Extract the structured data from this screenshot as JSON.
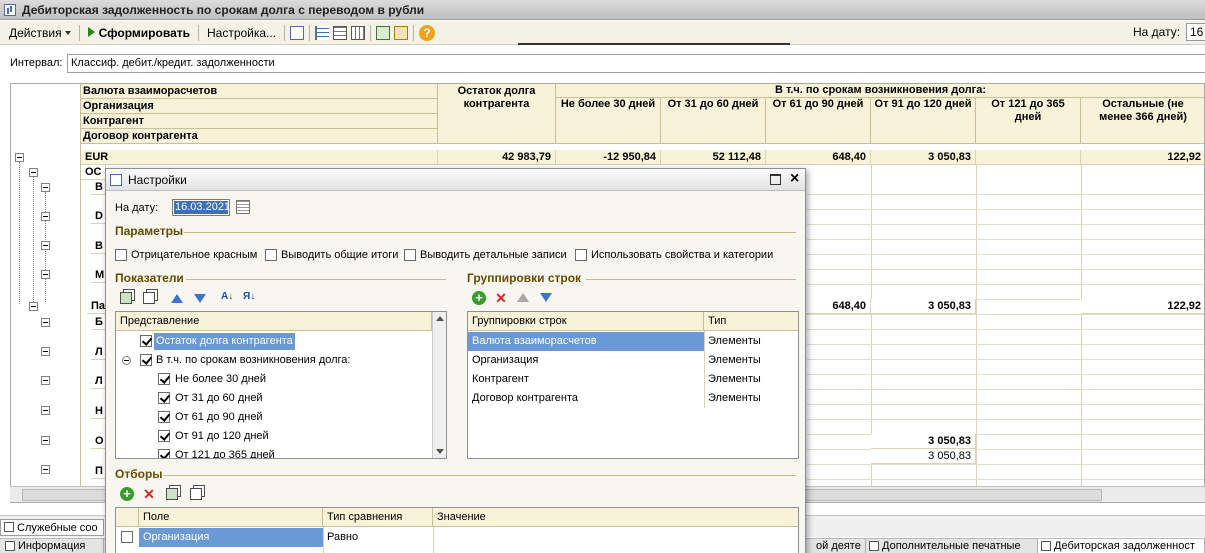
{
  "window": {
    "title": "Дебиторская задолженность по срокам долга с переводом в рубли"
  },
  "toolbar": {
    "actions_label": "Действия",
    "generate_label": "Сформировать",
    "settings_label": "Настройка...",
    "date_label": "На дату:",
    "date_value": "16"
  },
  "interval": {
    "label": "Интервал:",
    "value": "Классиф. дебит./кредит. задолженности"
  },
  "report": {
    "group_headers": [
      "Валюта взаиморасчетов",
      "Организация",
      "Контрагент",
      "Договор контрагента"
    ],
    "balance_header": "Остаток долга контрагента",
    "span_header": "В т.ч. по срокам возникновения долга:",
    "period_headers": [
      "Не более 30 дней",
      "От 31 до 60 дней",
      "От 61 до 90 дней",
      "От 91 до 120 дней",
      "От 121 до 365 дней",
      "Остальные (не менее 366 дней)"
    ],
    "eur_row": {
      "label": "EUR",
      "values": [
        "42 983,79",
        "-12 950,84",
        "52 112,48",
        "648,40",
        "3 050,83",
        "",
        "122,92"
      ]
    },
    "row_labels": [
      "ОС",
      "В",
      "D",
      "В",
      "М",
      "Па",
      "Б",
      "Л",
      "Л",
      "Н",
      "О",
      "П"
    ],
    "pa_row_values": {
      "d61_90": "648,40",
      "d91_120": "3 050,83",
      "rest": "122,92"
    },
    "o_row_values": {
      "d91_120_bold": "3 050,83",
      "d91_120": "3 050,83"
    }
  },
  "taskbar": {
    "sys_tab": "Служебные соо",
    "tabs": [
      "Информация",
      "ой деяте",
      "Дополнительные печатные",
      "Дебиторская задолженност"
    ]
  },
  "dialog": {
    "title": "Настройки",
    "date_label": "На дату:",
    "date_value": "16.03.2021",
    "params_title": "Параметры",
    "params": [
      "Отрицательное красным",
      "Выводить общие итоги",
      "Выводить детальные записи",
      "Использовать свойства и категории"
    ],
    "indicators_title": "Показатели",
    "indicators_header": "Представление",
    "indicators": [
      {
        "label": "Остаток долга контрагента",
        "checked": true,
        "level": 0,
        "selected": true
      },
      {
        "label": "В т.ч. по срокам возникновения долга:",
        "checked": true,
        "level": 0,
        "group": true
      },
      {
        "label": "Не более 30 дней",
        "checked": true,
        "level": 1
      },
      {
        "label": "От 31 до 60 дней",
        "checked": true,
        "level": 1
      },
      {
        "label": "От 61 до 90 дней",
        "checked": true,
        "level": 1
      },
      {
        "label": "От 91 до 120 дней",
        "checked": true,
        "level": 1
      },
      {
        "label": "От 121 до 365 дней",
        "checked": true,
        "level": 1
      }
    ],
    "groupings_title": "Группировки строк",
    "groupings_headers": [
      "Группировки строк",
      "Тип"
    ],
    "groupings": [
      {
        "name": "Валюта взаиморасчетов",
        "type": "Элементы"
      },
      {
        "name": "Организация",
        "type": "Элементы"
      },
      {
        "name": "Контрагент",
        "type": "Элементы"
      },
      {
        "name": "Договор контрагента",
        "type": "Элементы"
      }
    ],
    "filters_title": "Отборы",
    "filters_headers": [
      "Поле",
      "Тип сравнения",
      "Значение"
    ],
    "filters": [
      {
        "field": "Организация",
        "comparison": "Равно",
        "value": ""
      }
    ]
  },
  "colors": {
    "header_bg": "#f8f2d8",
    "selection": "#6b98d6",
    "section_title": "#6a4a00"
  }
}
